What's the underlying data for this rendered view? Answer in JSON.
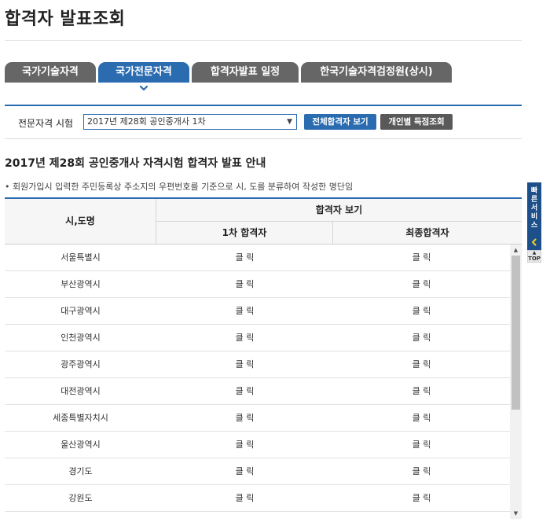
{
  "page": {
    "title": "합격자 발표조회"
  },
  "tabs": [
    {
      "label": "국가기술자격",
      "active": false
    },
    {
      "label": "국가전문자격",
      "active": true
    },
    {
      "label": "합격자발표 일정",
      "active": false
    },
    {
      "label": "한국기술자격검정원(상시)",
      "active": false
    }
  ],
  "form": {
    "exam_label": "전문자격 시험",
    "exam_selected": "2017년 제28회 공인중개사 1차",
    "btn_all": "전체합격자 보기",
    "btn_personal": "개인별 득점조회"
  },
  "notice": {
    "title": "2017년 제28회 공인중개사 자격시험 합격자 발표 안내",
    "text": "• 회원가입시 입력한 주민등록상 주소지의 우편번호를 기준으로 시, 도를 분류하여 작성한 명단임"
  },
  "table": {
    "col_city": "시,도명",
    "col_view": "합격자 보기",
    "col_first": "1차 합격자",
    "col_final": "최종합격자",
    "rows": [
      {
        "city": "서울특별시",
        "first": "클 릭",
        "final": "클 릭"
      },
      {
        "city": "부산광역시",
        "first": "클 릭",
        "final": "클 릭"
      },
      {
        "city": "대구광역시",
        "first": "클 릭",
        "final": "클 릭"
      },
      {
        "city": "인천광역시",
        "first": "클 릭",
        "final": "클 릭"
      },
      {
        "city": "광주광역시",
        "first": "클 릭",
        "final": "클 릭"
      },
      {
        "city": "대전광역시",
        "first": "클 릭",
        "final": "클 릭"
      },
      {
        "city": "세종특별자치시",
        "first": "클 릭",
        "final": "클 릭"
      },
      {
        "city": "울산광역시",
        "first": "클 릭",
        "final": "클 릭"
      },
      {
        "city": "경기도",
        "first": "클 릭",
        "final": "클 릭"
      },
      {
        "city": "강원도",
        "first": "클 릭",
        "final": "클 릭"
      }
    ]
  },
  "quick_service": {
    "label": "빠른서비스",
    "top": "TOP"
  },
  "colors": {
    "accent": "#2b6cb0",
    "tab_inactive": "#666666",
    "quick_bg": "#1d4f8a"
  },
  "icons": {
    "tab_arrow": "chevron-down-icon",
    "quick_arrow": "chevron-left-icon"
  }
}
